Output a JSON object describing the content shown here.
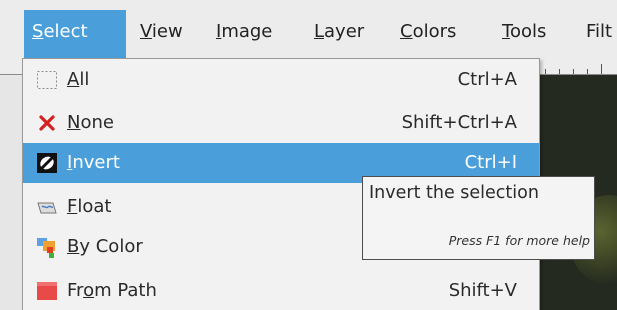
{
  "menubar": {
    "items": [
      {
        "mnemonic": "S",
        "rest": "elect",
        "active": true
      },
      {
        "mnemonic": "V",
        "rest": "iew"
      },
      {
        "mnemonic": "I",
        "rest": "mage"
      },
      {
        "mnemonic": "L",
        "rest": "ayer"
      },
      {
        "mnemonic": "C",
        "rest": "olors"
      },
      {
        "mnemonic": "T",
        "rest": "ools"
      },
      {
        "pre": "Filt",
        "rest": ""
      }
    ]
  },
  "select_menu": {
    "items": [
      {
        "icon": "selection-all-icon",
        "pre": "",
        "mnemonic": "A",
        "post": "ll",
        "shortcut": "Ctrl+A"
      },
      {
        "icon": "selection-none-icon",
        "pre": "",
        "mnemonic": "N",
        "post": "one",
        "shortcut": "Shift+Ctrl+A"
      },
      {
        "icon": "selection-invert-icon",
        "pre": "",
        "mnemonic": "I",
        "post": "nvert",
        "shortcut": "Ctrl+I",
        "highlighted": true
      },
      {
        "icon": "float-icon",
        "pre": "",
        "mnemonic": "F",
        "post": "loat",
        "shortcut": ""
      },
      {
        "icon": "by-color-icon",
        "pre": "",
        "mnemonic": "B",
        "post": "y Color",
        "shortcut": ""
      },
      {
        "icon": "from-path-icon",
        "pre": "Fr",
        "mnemonic": "o",
        "post": "m Path",
        "shortcut": "Shift+V"
      }
    ]
  },
  "tooltip": {
    "title": "Invert the selection",
    "help": "Press F1 for more help"
  },
  "colors": {
    "highlight": "#4a9ed9",
    "menu_background": "#f2f2f2",
    "none_icon": "#d42020"
  }
}
